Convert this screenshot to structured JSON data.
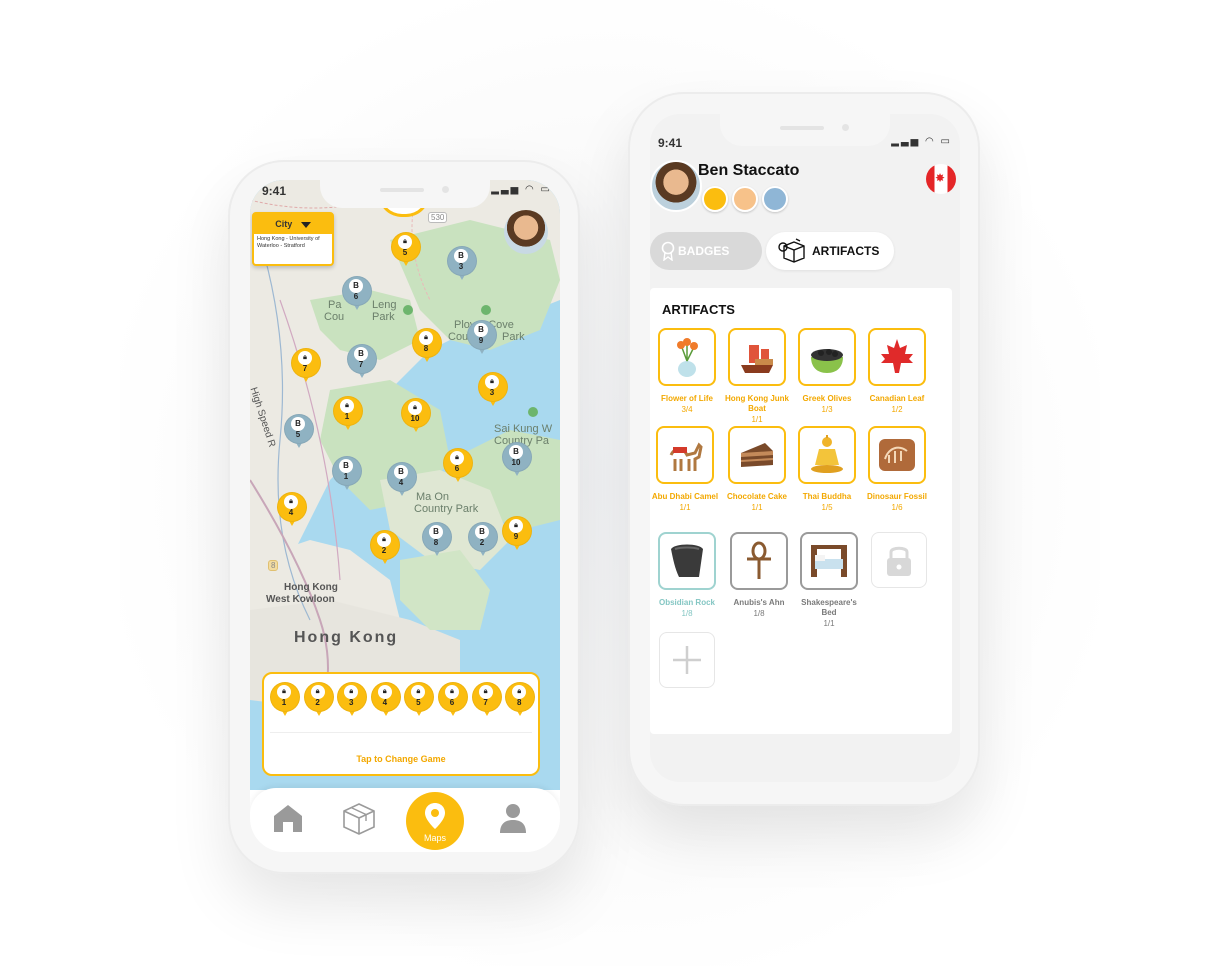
{
  "left_phone": {
    "status_time": "9:41",
    "city_selector": {
      "label": "City",
      "subtitle": "Hong Kong - University of Waterloo - Stratford"
    },
    "road_badge": "530",
    "map_labels": {
      "pat_sin_leng_left": "Pa",
      "pat_sin_leng_right": "Leng",
      "pat_sin_leng_bottom_left": "Cou",
      "pat_sin_leng_bottom_right": "Park",
      "plover_cove_1": "Plover Cove",
      "plover_cove_2": "Cou",
      "plover_cove_3": "Park",
      "sai_kung_1": "Sai Kung W",
      "sai_kung_2": "Country Pa",
      "ma_on_shan_1": "Ma On",
      "ma_on_shan_2": "Country Park",
      "west_kowloon_1": "Hong Kong",
      "west_kowloon_2": "West Kowloon",
      "hong_kong": "Hong Kong",
      "high_speed": "High Speed R",
      "route_8": "8"
    },
    "map_pins": [
      {
        "kind": "lock",
        "color": "yellow",
        "num": "5"
      },
      {
        "kind": "B",
        "color": "gray",
        "num": "3"
      },
      {
        "kind": "B",
        "color": "gray",
        "num": "6"
      },
      {
        "kind": "B",
        "color": "gray",
        "num": "9"
      },
      {
        "kind": "lock",
        "color": "yellow",
        "num": "8"
      },
      {
        "kind": "B",
        "color": "gray",
        "num": "7"
      },
      {
        "kind": "lock",
        "color": "yellow",
        "num": "7"
      },
      {
        "kind": "lock",
        "color": "yellow",
        "num": "3"
      },
      {
        "kind": "lock",
        "color": "yellow",
        "num": "1"
      },
      {
        "kind": "lock",
        "color": "yellow",
        "num": "10"
      },
      {
        "kind": "B",
        "color": "gray",
        "num": "5"
      },
      {
        "kind": "lock",
        "color": "yellow",
        "num": "6"
      },
      {
        "kind": "B",
        "color": "gray",
        "num": "10"
      },
      {
        "kind": "B",
        "color": "gray",
        "num": "1"
      },
      {
        "kind": "B",
        "color": "gray",
        "num": "4"
      },
      {
        "kind": "lock",
        "color": "yellow",
        "num": "4"
      },
      {
        "kind": "lock",
        "color": "yellow",
        "num": "2"
      },
      {
        "kind": "B",
        "color": "gray",
        "num": "8"
      },
      {
        "kind": "B",
        "color": "gray",
        "num": "2"
      },
      {
        "kind": "lock",
        "color": "yellow",
        "num": "9"
      }
    ],
    "game_panel": {
      "pins": [
        "1",
        "2",
        "3",
        "4",
        "5",
        "6",
        "7",
        "8"
      ],
      "tap_label": "Tap to Change Game"
    },
    "tabbar": {
      "home_icon": "home-icon",
      "artifacts_icon": "cube-icon",
      "maps_label": "Maps",
      "profile_icon": "user-icon"
    }
  },
  "right_phone": {
    "status_time": "9:41",
    "profile": {
      "name": "Ben Staccato",
      "country_flag": "canada-flag-icon"
    },
    "tabs": {
      "badges": "BADGES",
      "artifacts": "ARTIFACTS"
    },
    "section_title": "ARTIFACTS",
    "artifacts": [
      {
        "name": "Flower of Life",
        "count": "3/4",
        "icon": "flower-vase-icon",
        "state": "gold"
      },
      {
        "name": "Hong Kong Junk Boat",
        "count": "1/1",
        "icon": "junk-boat-icon",
        "state": "gold"
      },
      {
        "name": "Greek Olives",
        "count": "1/3",
        "icon": "olives-bowl-icon",
        "state": "gold"
      },
      {
        "name": "Canadian Leaf",
        "count": "1/2",
        "icon": "maple-leaf-icon",
        "state": "gold"
      },
      {
        "name": "Abu Dhabi Camel",
        "count": "1/1",
        "icon": "camel-icon",
        "state": "gold"
      },
      {
        "name": "Chocolate Cake",
        "count": "1/1",
        "icon": "cake-icon",
        "state": "gold"
      },
      {
        "name": "Thai Buddha",
        "count": "1/5",
        "icon": "buddha-icon",
        "state": "gold"
      },
      {
        "name": "Dinosaur Fossil",
        "count": "1/6",
        "icon": "fossil-icon",
        "state": "gold"
      },
      {
        "name": "Obsidian Rock",
        "count": "1/8",
        "icon": "obsidian-rock-icon",
        "state": "teal"
      },
      {
        "name": "Anubis's Ahn",
        "count": "1/8",
        "icon": "ankh-icon",
        "state": "gray"
      },
      {
        "name": "Shakespeare's Bed",
        "count": "1/1",
        "icon": "bed-icon",
        "state": "gray"
      }
    ],
    "accent_color": "#fbbd0f"
  }
}
